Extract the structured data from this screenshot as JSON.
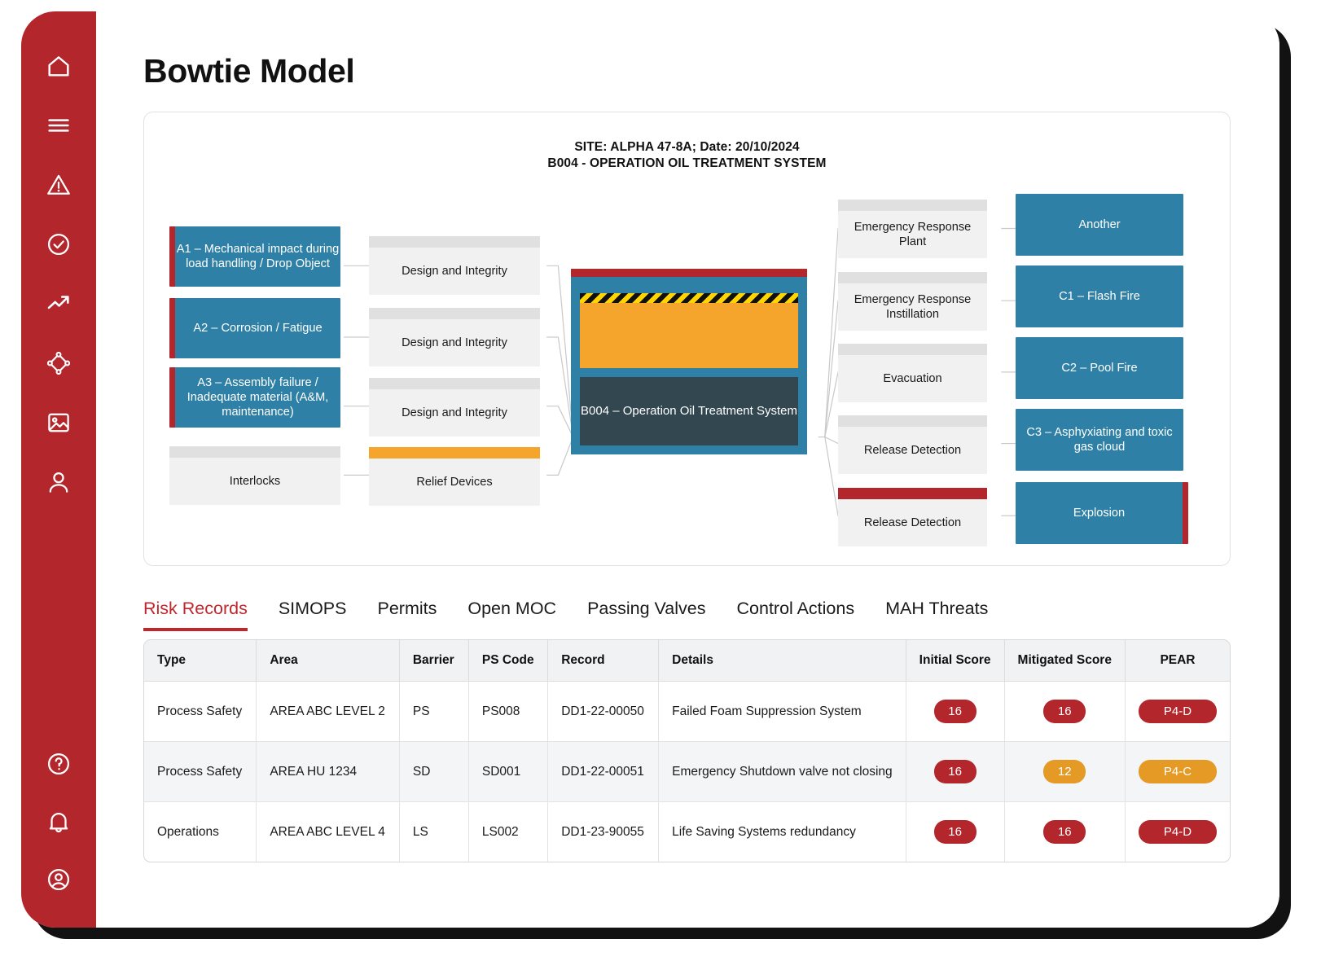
{
  "app": {
    "page_title": "Bowtie Model"
  },
  "sidebar": {
    "top_items": [
      {
        "name": "home-icon",
        "label": "Home"
      },
      {
        "name": "menu-icon",
        "label": "Menu"
      },
      {
        "name": "warning-triangle-icon",
        "label": "Alerts"
      },
      {
        "name": "check-circle-icon",
        "label": "Approvals"
      },
      {
        "name": "trending-up-icon",
        "label": "Trends"
      },
      {
        "name": "network-nodes-icon",
        "label": "Network"
      },
      {
        "name": "image-icon",
        "label": "Media"
      },
      {
        "name": "user-icon",
        "label": "Profile"
      }
    ],
    "bottom_items": [
      {
        "name": "help-circle-icon",
        "label": "Help"
      },
      {
        "name": "bell-icon",
        "label": "Notifications"
      },
      {
        "name": "account-circle-icon",
        "label": "Account"
      }
    ]
  },
  "bowtie": {
    "header_line1": "SITE: ALPHA 47-8A; Date: 20/10/2024",
    "header_line2": "B004 - OPERATION OIL TREATMENT SYSTEM",
    "hazard": {
      "label": "B004 – Operation Oil Treatment System"
    },
    "threats": [
      {
        "label": "A1 – Mechanical impact during load handling / Drop Object"
      },
      {
        "label": "A2 – Corrosion / Fatigue"
      },
      {
        "label": "A3 – Assembly failure / Inadequate material (A&M, maintenance)"
      }
    ],
    "threat_extra": [
      {
        "label": "Interlocks",
        "cap": "grey"
      }
    ],
    "prevention_barriers": [
      {
        "label": "Design and Integrity",
        "cap": "grey"
      },
      {
        "label": "Design and Integrity",
        "cap": "grey"
      },
      {
        "label": "Design and Integrity",
        "cap": "grey"
      },
      {
        "label": "Relief Devices",
        "cap": "orange"
      }
    ],
    "mitigation_barriers": [
      {
        "label": "Emergency Response Plant",
        "cap": "grey"
      },
      {
        "label": "Emergency Response Instillation",
        "cap": "grey"
      },
      {
        "label": "Evacuation",
        "cap": "grey"
      },
      {
        "label": "Release Detection",
        "cap": "grey"
      },
      {
        "label": "Release Detection",
        "cap": "red"
      }
    ],
    "consequences": [
      {
        "label": "Another",
        "bar": "none"
      },
      {
        "label": "C1 – Flash Fire",
        "bar": "none"
      },
      {
        "label": "C2 – Pool Fire",
        "bar": "none"
      },
      {
        "label": "C3 – Asphyxiating and toxic gas cloud",
        "bar": "none"
      },
      {
        "label": "Explosion",
        "bar": "right-red"
      }
    ]
  },
  "tabs": [
    {
      "label": "Risk Records",
      "active": true
    },
    {
      "label": "SIMOPS",
      "active": false
    },
    {
      "label": "Permits",
      "active": false
    },
    {
      "label": "Open MOC",
      "active": false
    },
    {
      "label": "Passing Valves",
      "active": false
    },
    {
      "label": "Control Actions",
      "active": false
    },
    {
      "label": "MAH Threats",
      "active": false
    }
  ],
  "table": {
    "columns": [
      "Type",
      "Area",
      "Barrier",
      "PS Code",
      "Record",
      "Details",
      "Initial Score",
      "Mitigated Score",
      "PEAR"
    ],
    "rows": [
      {
        "type": "Process Safety",
        "area": "AREA ABC LEVEL 2",
        "barrier": "PS",
        "ps_code": "PS008",
        "record": "DD1-22-00050",
        "details": "Failed Foam Suppression System",
        "initial_score": "16",
        "initial_color": "red",
        "mitigated_score": "16",
        "mitigated_color": "red",
        "pear": "P4-D",
        "pear_color": "red"
      },
      {
        "type": "Process Safety",
        "area": "AREA HU 1234",
        "barrier": "SD",
        "ps_code": "SD001",
        "record": "DD1-22-00051",
        "details": "Emergency Shutdown valve not closing",
        "initial_score": "16",
        "initial_color": "red",
        "mitigated_score": "12",
        "mitigated_color": "orange",
        "pear": "P4-C",
        "pear_color": "orange"
      },
      {
        "type": "Operations",
        "area": "AREA ABC LEVEL 4",
        "barrier": "LS",
        "ps_code": "LS002",
        "record": "DD1-23-90055",
        "details": "Life Saving Systems redundancy",
        "initial_score": "16",
        "initial_color": "red",
        "mitigated_score": "16",
        "mitigated_color": "red",
        "pear": "P4-D",
        "pear_color": "red"
      }
    ]
  },
  "colors": {
    "brand_red": "#b3262c",
    "accent_blue": "#2e80a6",
    "hazard_orange": "#f5a52b",
    "navy": "#334751",
    "barrier_grey": "#f1f1f1",
    "warn_orange": "#e49a24"
  }
}
